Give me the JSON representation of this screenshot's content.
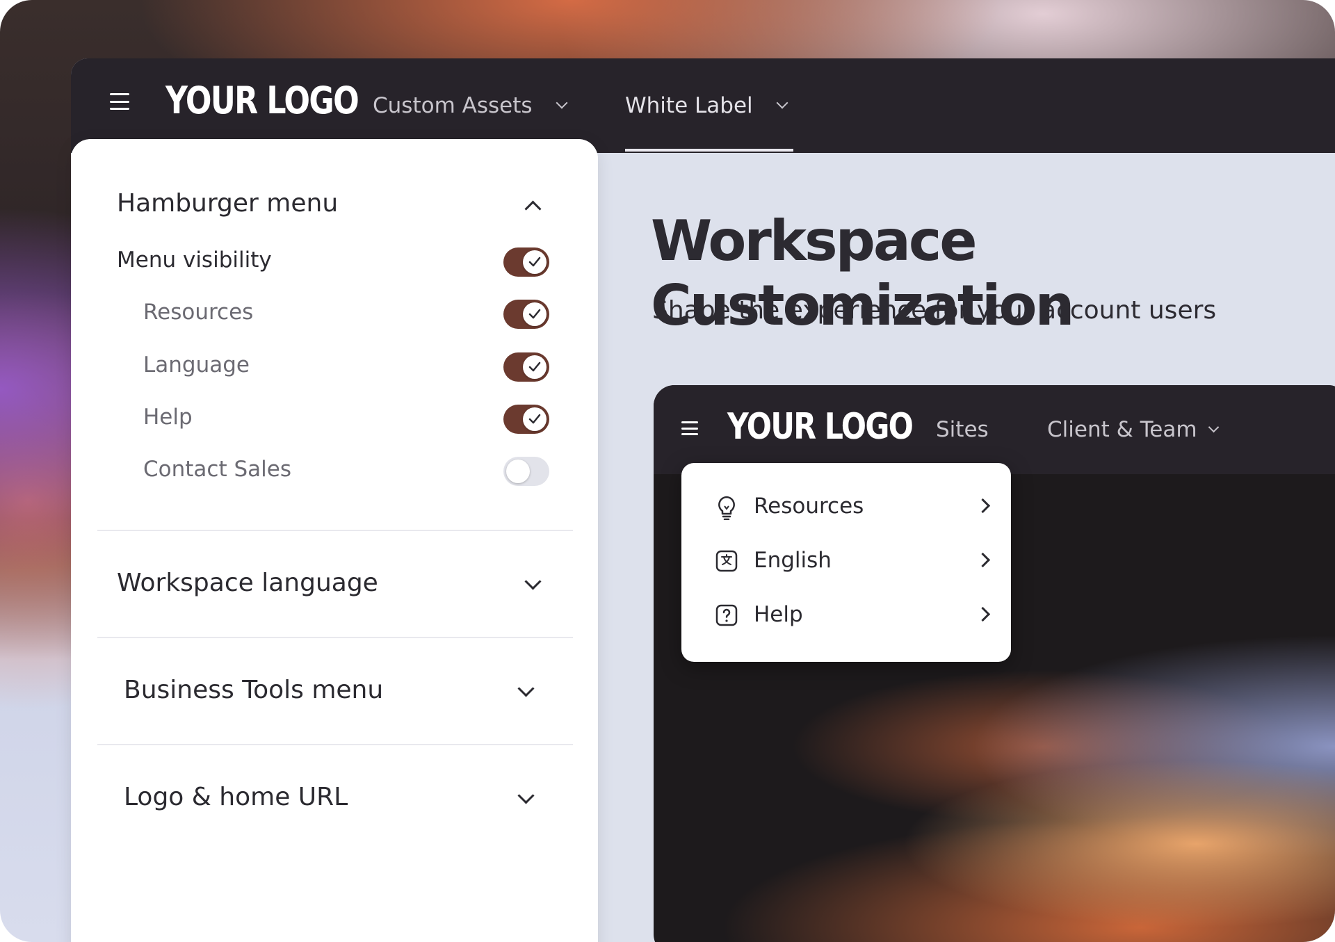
{
  "topbar": {
    "logo": "YOUR LOGO",
    "nav": [
      {
        "label": "Custom Assets",
        "has_dropdown": true,
        "active": false
      },
      {
        "label": "White Label",
        "has_dropdown": true,
        "active": true
      }
    ]
  },
  "settings": {
    "sections": [
      {
        "title": "Hamburger menu",
        "expanded": true,
        "rows": [
          {
            "label": "Menu visibility",
            "enabled": true,
            "level": "main"
          },
          {
            "label": "Resources",
            "enabled": true,
            "level": "sub"
          },
          {
            "label": "Language",
            "enabled": true,
            "level": "sub"
          },
          {
            "label": "Help",
            "enabled": true,
            "level": "sub"
          },
          {
            "label": "Contact Sales",
            "enabled": false,
            "level": "sub"
          }
        ]
      },
      {
        "title": "Workspace language",
        "expanded": false
      },
      {
        "title": "Business Tools menu",
        "expanded": false
      },
      {
        "title": "Logo & home URL",
        "expanded": false
      }
    ]
  },
  "hero": {
    "title": "Workspace Customization",
    "subtitle": "Shape the experience for your account users"
  },
  "preview": {
    "logo": "YOUR LOGO",
    "nav": [
      {
        "label": "Sites",
        "has_dropdown": false
      },
      {
        "label": "Client & Team",
        "has_dropdown": true
      }
    ],
    "menu_items": [
      {
        "label": "Resources",
        "icon": "lightbulb-icon"
      },
      {
        "label": "English",
        "icon": "translate-icon"
      },
      {
        "label": "Help",
        "icon": "help-question-icon"
      }
    ]
  },
  "colors": {
    "toggle_on": "#6b3a2f",
    "toggle_off": "#e2e3ea",
    "topbar": "#27232a",
    "canvas": "#dde1ec"
  }
}
